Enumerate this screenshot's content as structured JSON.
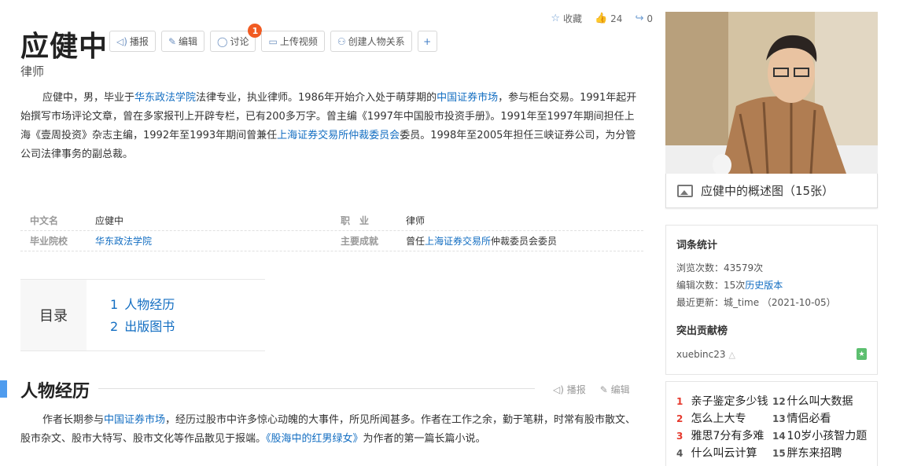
{
  "header": {
    "title": "应健中",
    "subtitle": "律师",
    "favorite_label": "收藏",
    "like_count": "24",
    "share_count": "0"
  },
  "toolbar": {
    "report": "播报",
    "edit": "编辑",
    "discuss": "讨论",
    "discuss_badge": "1",
    "upload_video": "上传视频",
    "create_relation": "创建人物关系",
    "add": "+"
  },
  "summary": {
    "p1": "应健中，男，毕业于",
    "link1": "华东政法学院",
    "p2": "法律专业，执业律师。1986年开始介入处于萌芽期的",
    "link2": "中国证券市场",
    "p3": "，参与柜台交易。1991年起开始撰写市场评论文章，曾在多家报刊上开辟专栏，已有200多万字。曾主编《1997年中国股市投资手册》。1991年至1997年期间担任上海《壹周投资》杂志主编，1992年至1993年期间曾兼任",
    "link3": "上海证券交易所仲裁委员会",
    "p4": "委员。1998年至2005年担任三峡证券公司，为分管公司法律事务的副总裁。"
  },
  "infobox": {
    "chinese_name_label": "中文名",
    "chinese_name": "应健中",
    "occupation_label": "职　业",
    "occupation": "律师",
    "school_label": "毕业院校",
    "school": "华东政法学院",
    "achievement_label": "主要成就",
    "achievement_pre": "曾任",
    "achievement_link": "上海证券交易所",
    "achievement_post": "仲裁委员会委员"
  },
  "toc": {
    "title": "目录",
    "items": [
      {
        "num": "1",
        "label": "人物经历"
      },
      {
        "num": "2",
        "label": "出版图书"
      }
    ]
  },
  "section": {
    "title": "人物经历",
    "report": "播报",
    "edit": "编辑",
    "t1": "作者长期参与",
    "link1": "中国证券市场",
    "t2": "，经历过股市中许多惊心动魄的大事件，所见所闻甚多。作者在工作之余，勤于笔耕，时常有股市散文、股市杂文、股市大特写、股市文化等作品散见于报端。",
    "link2": "《股海中的红男绿女》",
    "t3": "为作者的第一篇长篇小说。"
  },
  "sidebar": {
    "caption": "应健中的概述图（15张）",
    "stats_title": "词条统计",
    "views": "浏览次数：43579次",
    "edits_pre": "编辑次数：15次",
    "edits_link": "历史版本",
    "updated": "最近更新：城_time （2021-10-05）",
    "contrib_title": "突出贡献榜",
    "contributor": "xuebinc23"
  },
  "hot_list": [
    {
      "rank": "1",
      "label": "亲子鉴定多少钱"
    },
    {
      "rank": "12",
      "label": "什么叫大数据"
    },
    {
      "rank": "2",
      "label": "怎么上大专"
    },
    {
      "rank": "13",
      "label": "情侣必看"
    },
    {
      "rank": "3",
      "label": "雅思7分有多难"
    },
    {
      "rank": "14",
      "label": "10岁小孩智力题"
    },
    {
      "rank": "4",
      "label": "什么叫云计算"
    },
    {
      "rank": "15",
      "label": "胖东来招聘"
    }
  ],
  "colors": {
    "link": "#136ec2",
    "badge": "#f15b22",
    "section_bar": "#4f9cee",
    "rank_top": "#e63a2e"
  }
}
